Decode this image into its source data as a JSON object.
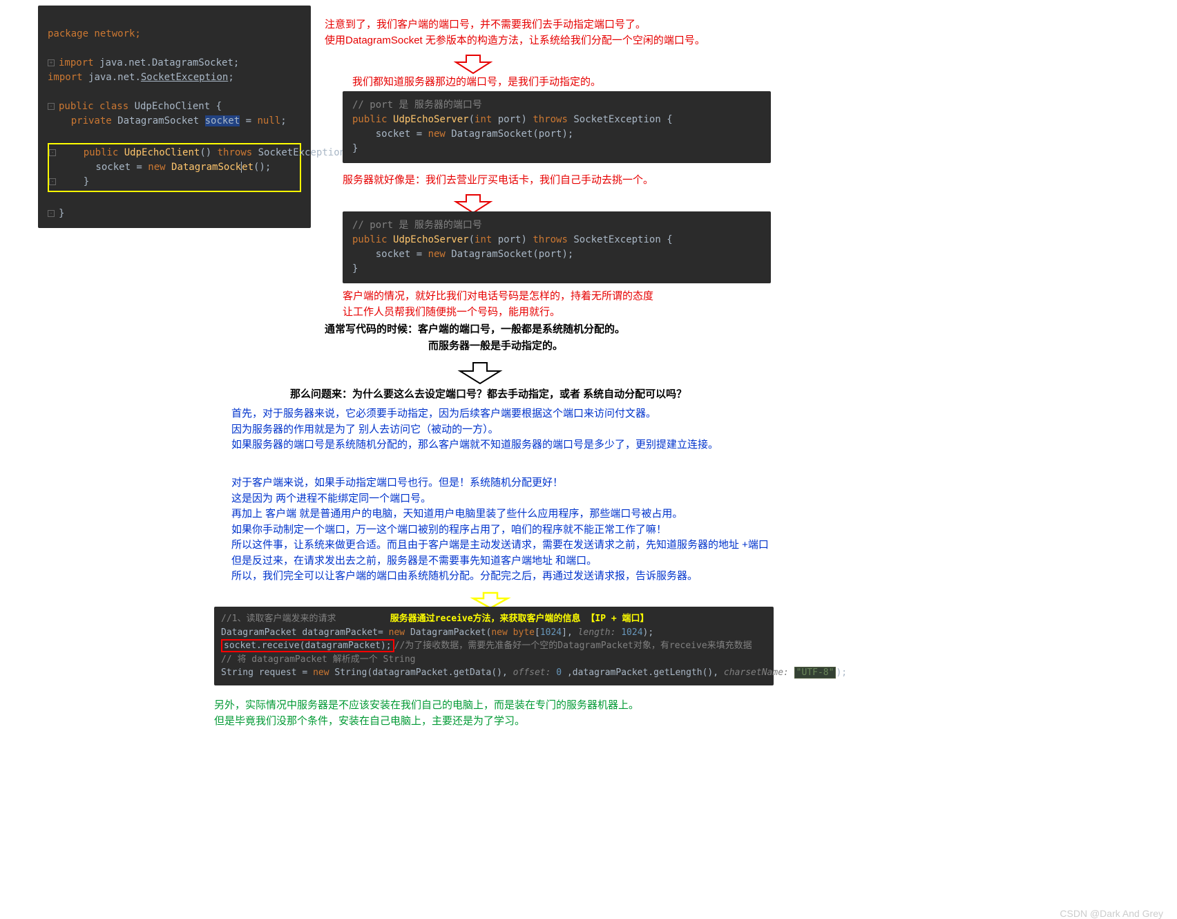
{
  "colors": {
    "red": "#e60000",
    "blue": "#0033cc",
    "green": "#009933",
    "black": "#000"
  },
  "code_left": {
    "l1": "package network;",
    "l2": "import java.net.DatagramSocket;",
    "l3": "import java.net.SocketException;",
    "l4a": "public ",
    "l4b": "class ",
    "l4c": "UdpEchoClient {",
    "l5a": "    private ",
    "l5b": "DatagramSocket ",
    "l5c": "socket",
    "l5d": " = ",
    "l5e": "null",
    "l5f": ";",
    "l6a": "    public ",
    "l6b": "UdpEchoClient",
    "l6c": "() ",
    "l6d": "throws ",
    "l6e": "SocketException {",
    "l7a": "        socket = ",
    "l7b": "new ",
    "l7c": "DatagramSock",
    "l7ct": "et",
    "l7d": "();",
    "l8": "    }",
    "l9": "}"
  },
  "annotation1": {
    "line1": "注意到了，我们客户端的端口号，并不需要我们去手动指定端口号了。",
    "line2": "使用DatagramSocket 无参版本的构造方法，让系统给我们分配一个空闲的端口号。"
  },
  "annotation2": "我们都知道服务器那边的端口号，是我们手动指定的。",
  "code_server1": {
    "c1": "// port 是 服务器的端口号",
    "c2a": "public ",
    "c2b": "UdpEchoServer",
    "c2c": "(",
    "c2d": "int ",
    "c2e": "port) ",
    "c2f": "throws ",
    "c2g": "SocketException {",
    "c3a": "    socket = ",
    "c3b": "new ",
    "c3c": "DatagramSocket(port);",
    "c4": "}"
  },
  "annotation3": "服务器就好像是：我们去营业厅买电话卡，我们自己手动去挑一个。",
  "annotation4": {
    "line1": "客户端的情况，就好比我们对电话号码是怎样的，持着无所谓的态度",
    "line2": "让工作人员帮我们随便挑一个号码，能用就行。"
  },
  "annotation5": "通常写代码的时候：客户端的端口号，一般都是系统随机分配的。",
  "annotation6": "而服务器一般是手动指定的。",
  "annotation7": "那么问题来：为什么要这么去设定端口号？都去手动指定，或者 系统自动分配可以吗？",
  "para1": {
    "l1": "首先，对于服务器来说，它必须要手动指定，因为后续客户端要根据这个端口来访问付文器。",
    "l2": "因为服务器的作用就是为了 别人去访问它（被动的一方）。",
    "l3": "如果服务器的端口号是系统随机分配的，那么客户端就不知道服务器的端口号是多少了，更别提建立连接。"
  },
  "para2": {
    "l1": "对于客户端来说，如果手动指定端口号也行。但是！系统随机分配更好！",
    "l2": "这是因为 两个进程不能绑定同一个端口号。",
    "l3": "再加上 客户端 就是普通用户的电脑，天知道用户电脑里装了些什么应用程序，那些端口号被占用。",
    "l4": "如果你手动制定一个端口，万一这个端口被别的程序占用了，咱们的程序就不能正常工作了嘛！",
    "l5": "所以这件事，让系统来做更合适。而且由于客户端是主动发送请求，需要在发送请求之前，先知道服务器的地址 +端口",
    "l6": "但是反过来，在请求发出去之前，服务器是不需要事先知道客户端地址 和端口。",
    "l7": "所以，我们完全可以让客户端的端口由系统随机分配。分配完之后，再通过发送请求报，告诉服务器。"
  },
  "code_bottom": {
    "c1": "//1、读取客户端发来的请求",
    "ytext": "服务器通过receive方法，来获取客户端的信息 【IP + 端口】",
    "c2a": "DatagramPacket datagramPacket= ",
    "c2b": "new ",
    "c2c": "DatagramPacket(",
    "c2d": "new ",
    "c2e": "byte",
    "c2f": "[",
    "c2g": "1024",
    "c2h": "], ",
    "c2i": "length: ",
    "c2j": "1024",
    "c2k": ");",
    "c3a": "socket.receive(datagramPacket);",
    "c3b": "//为了接收数据，需要先准备好一个空的DatagramPacket对象，有receive来填充数据",
    "c4": "// 将 datagramPacket 解析成一个 String",
    "c5a": "String request = ",
    "c5b": "new ",
    "c5c": "String(datagramPacket.getData(), ",
    "c5d": "offset: ",
    "c5e": "0 ",
    "c5f": ",datagramPacket.getLength(), ",
    "c5g": "charsetName: ",
    "c5h": "\"UTF-8\"",
    "c5i": ");"
  },
  "para3": {
    "l1": "另外，实际情况中服务器是不应该安装在我们自己的电脑上，而是装在专门的服务器机器上。",
    "l2": "但是毕竟我们没那个条件，安装在自己电脑上，主要还是为了学习。"
  },
  "watermark": "CSDN @Dark And Grey"
}
